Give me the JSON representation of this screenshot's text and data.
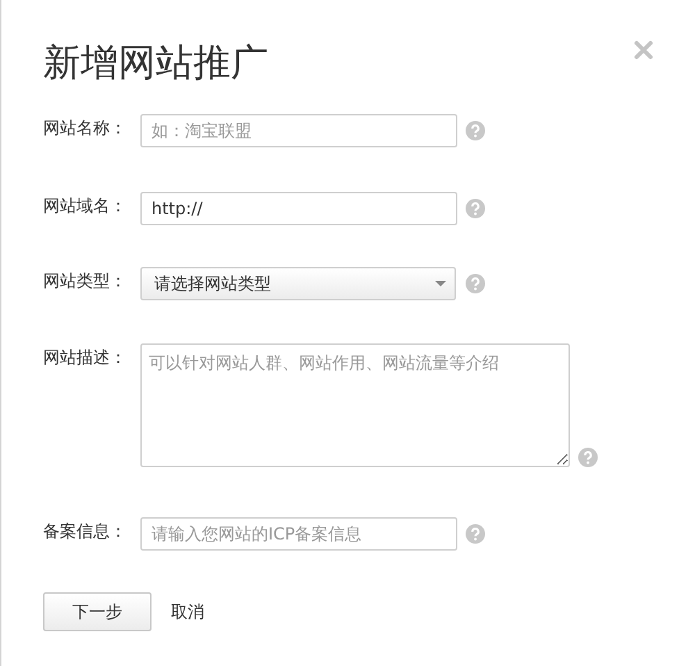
{
  "dialog": {
    "title": "新增网站推广"
  },
  "fields": [
    {
      "kind": "input",
      "label": "网站名称：",
      "placeholder": "如：淘宝联盟"
    },
    {
      "kind": "input",
      "label": "网站域名：",
      "value": "http://"
    },
    {
      "kind": "select",
      "label": "网站类型：",
      "value": "请选择网站类型"
    },
    {
      "kind": "textarea",
      "label": "网站描述：",
      "placeholder": "可以针对网站人群、网站作用、网站流量等介绍"
    },
    {
      "kind": "input",
      "label": "备案信息：",
      "placeholder": "请输入您网站的ICP备案信息"
    }
  ],
  "buttons": [
    {
      "kind": "primary",
      "label": "下一步"
    },
    {
      "kind": "link",
      "label": "取消"
    }
  ]
}
